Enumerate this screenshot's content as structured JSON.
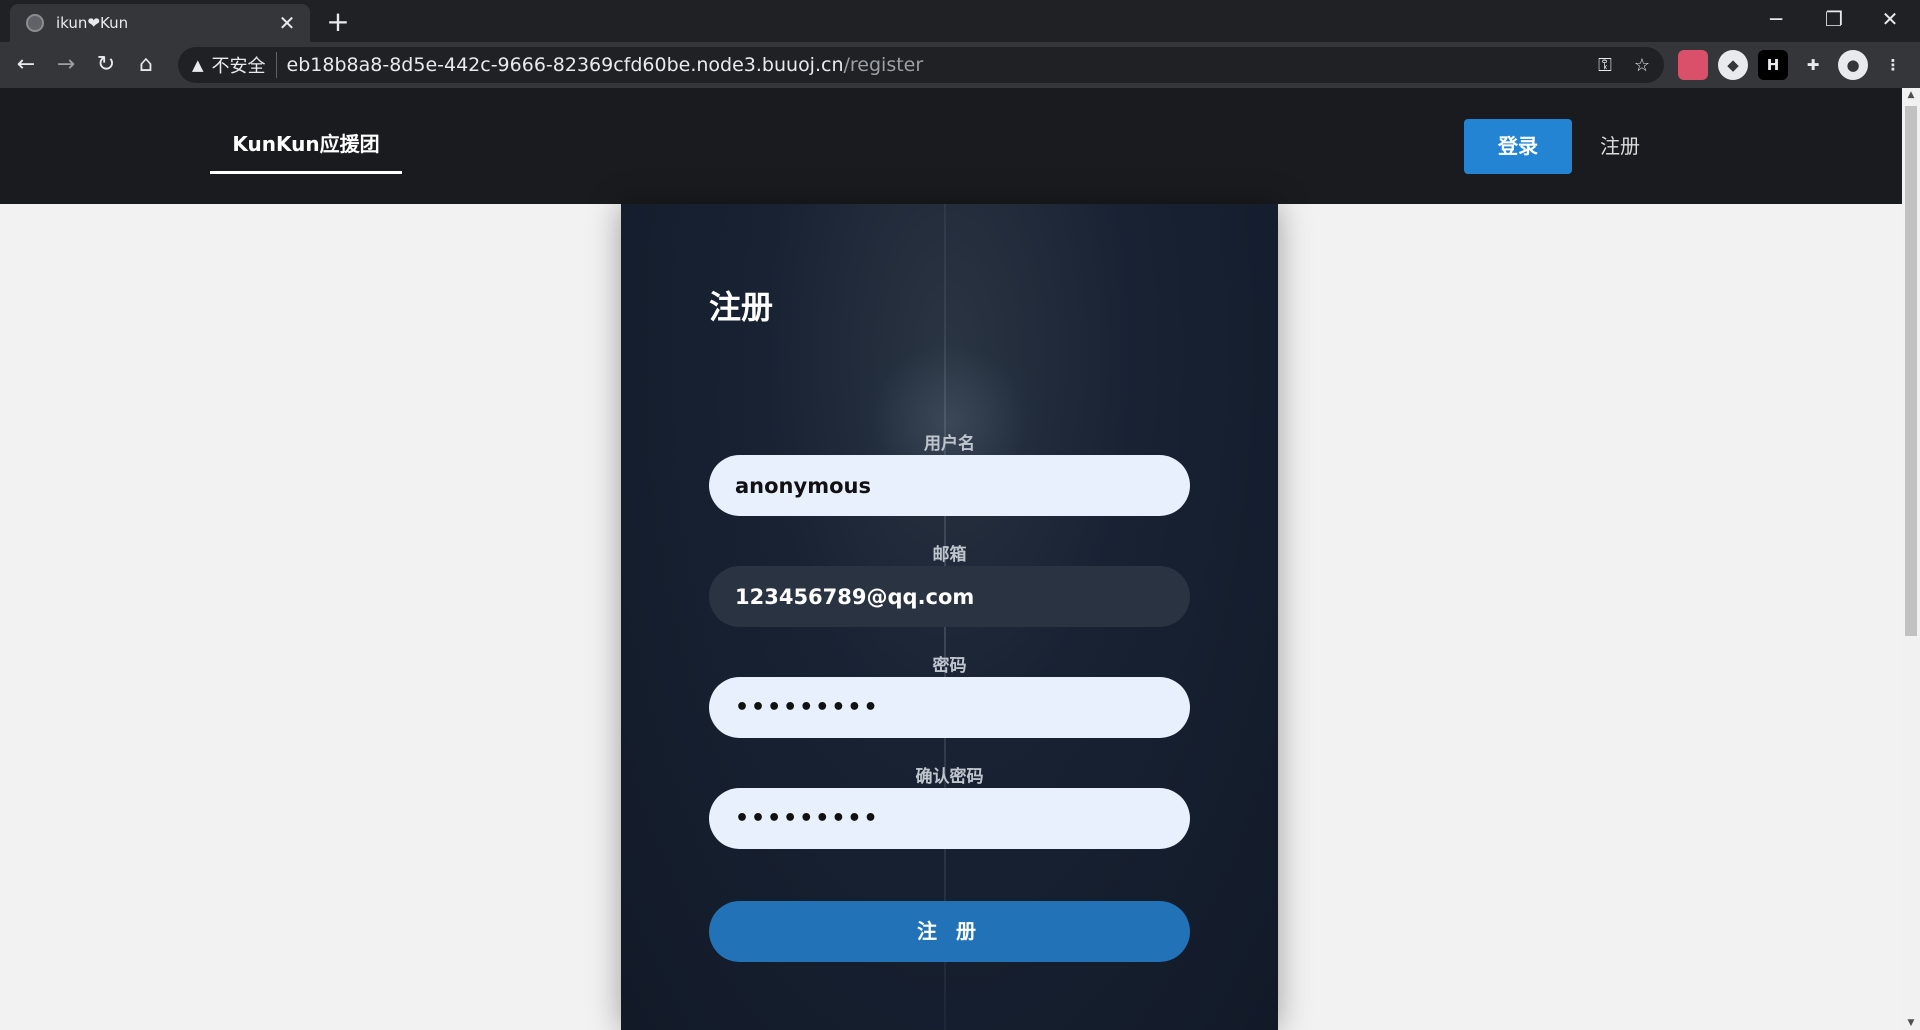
{
  "browser": {
    "tab_title": "ikun❤Kun",
    "tab_close": "✕",
    "new_tab": "+",
    "window_controls": [
      "─",
      "❐",
      "✕"
    ],
    "insecure_label": "不安全",
    "url_host": "eb18b8a8-8d5e-442c-9666-82369cfd60be.node3.buuoj.cn",
    "url_path": "/register",
    "icons": [
      "back-icon",
      "forward-icon",
      "reload-icon",
      "home-icon",
      "key-icon",
      "star-icon",
      "puzzle-icon",
      "profile-icon",
      "menu-icon"
    ],
    "extensions": [
      "ext-colorful",
      "ext-fox",
      "H"
    ]
  },
  "nav": {
    "brand": "KunKun应援团",
    "login": "登录",
    "register": "注册"
  },
  "form": {
    "title": "注册",
    "username_label": "用户名",
    "username_value": "anonymous",
    "email_label": "邮箱",
    "email_value": "123456789@qq.com",
    "password_label": "密码",
    "password_value": "•••••••••",
    "confirm_label": "确认密码",
    "confirm_value": "•••••••••",
    "submit": "注 册"
  },
  "colors": {
    "accent": "#2484d4",
    "submit": "#2272b8",
    "nav_bg": "#1a1b1e"
  }
}
